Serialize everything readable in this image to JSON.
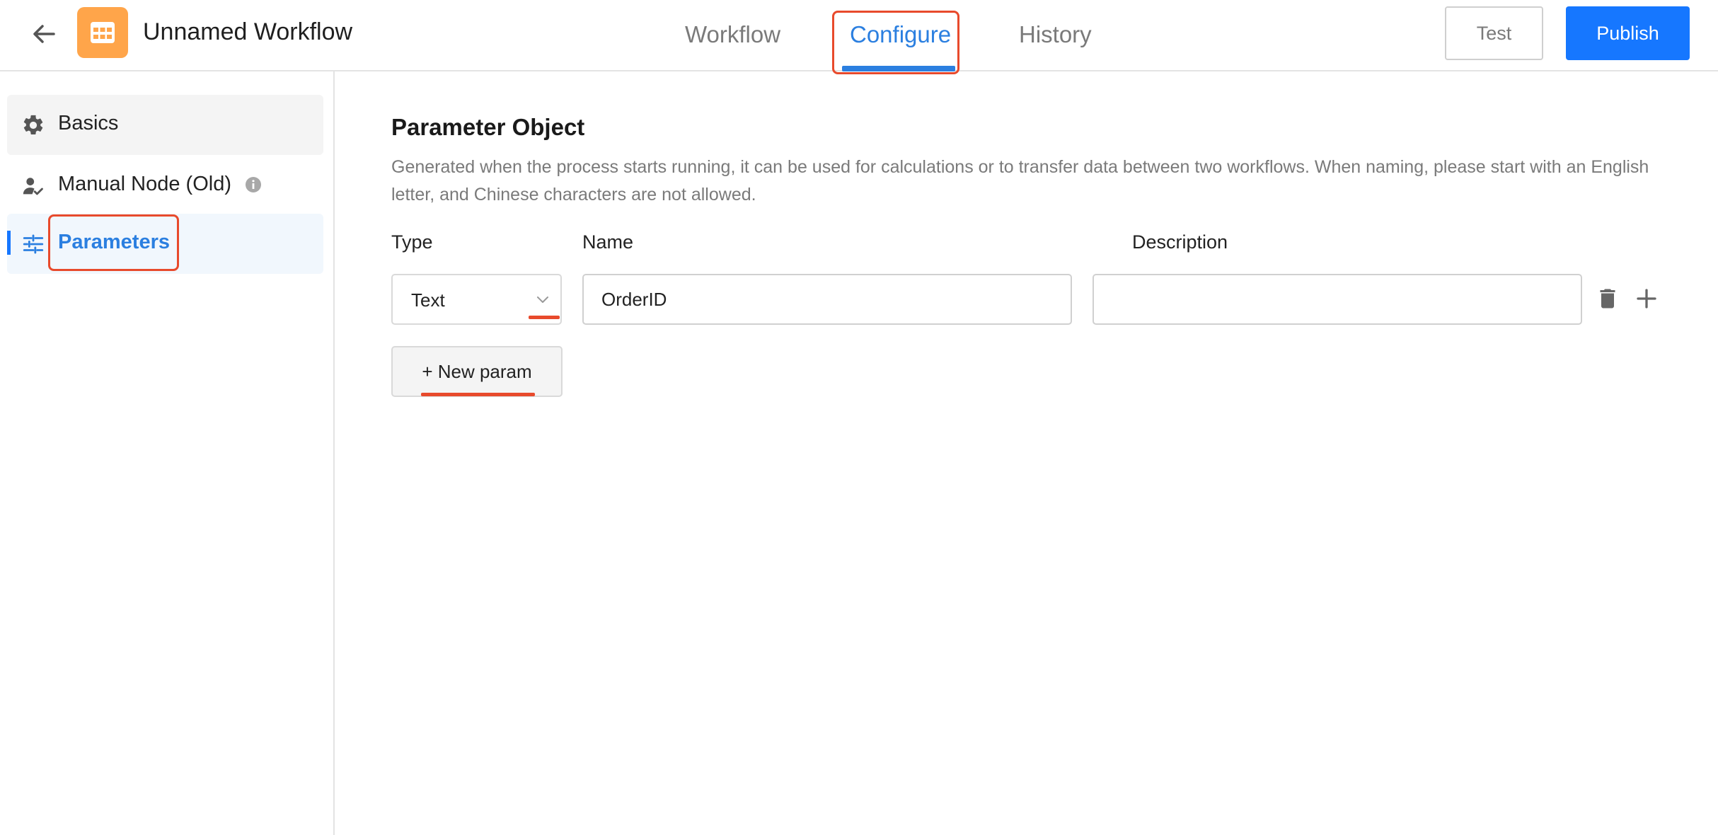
{
  "header": {
    "title": "Unnamed Workflow",
    "tabs": [
      {
        "label": "Workflow",
        "active": false
      },
      {
        "label": "Configure",
        "active": true
      },
      {
        "label": "History",
        "active": false
      }
    ],
    "test_label": "Test",
    "publish_label": "Publish"
  },
  "sidebar": {
    "items": [
      {
        "label": "Basics",
        "icon": "gear-icon"
      },
      {
        "label": "Manual Node (Old)",
        "icon": "user-check-icon",
        "info": true
      },
      {
        "label": "Parameters",
        "icon": "sliders-icon",
        "active": true
      }
    ]
  },
  "main": {
    "title": "Parameter Object",
    "description": "Generated when the process starts running, it can be used for calculations or to transfer data between two workflows. When naming, please start with an English letter, and Chinese characters are not allowed.",
    "columns": {
      "type": "Type",
      "name": "Name",
      "description": "Description"
    },
    "param_row": {
      "type": "Text",
      "name": "OrderID",
      "description": ""
    },
    "new_param_label": "+ New param"
  },
  "colors": {
    "accent": "#2b7fe0",
    "primary_button": "#1677ff",
    "logo": "#ffa54a",
    "annotation": "#e84a2c"
  }
}
